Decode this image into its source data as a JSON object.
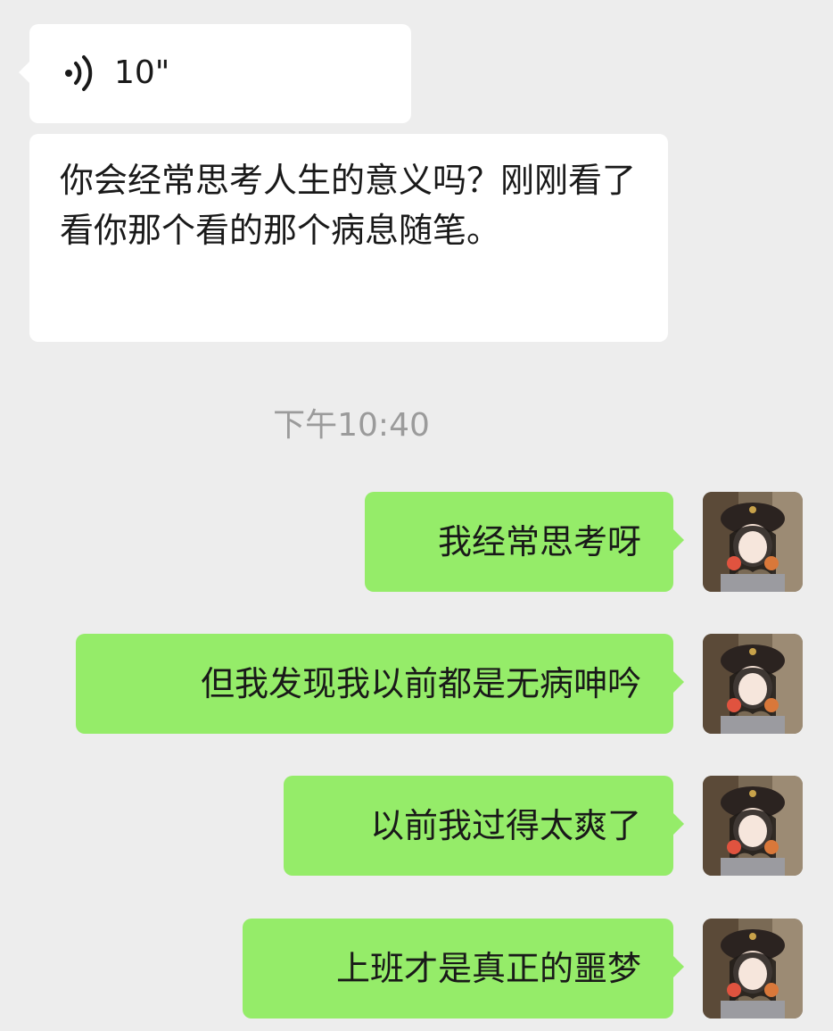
{
  "messages": {
    "incoming_voice": {
      "duration": "10\""
    },
    "incoming_text": {
      "text": "你会经常思考人生的意义吗？刚刚看了看你那个看的那个病息随笔。"
    },
    "timestamp": "下午10:40",
    "outgoing": [
      {
        "text": "我经常思考呀"
      },
      {
        "text": "但我发现我以前都是无病呻吟"
      },
      {
        "text": "以前我过得太爽了"
      },
      {
        "text": "上班才是真正的噩梦"
      }
    ]
  },
  "colors": {
    "background": "#ededed",
    "incoming_bubble": "#ffffff",
    "outgoing_bubble": "#95ec69",
    "timestamp_text": "#9b9b9b"
  }
}
